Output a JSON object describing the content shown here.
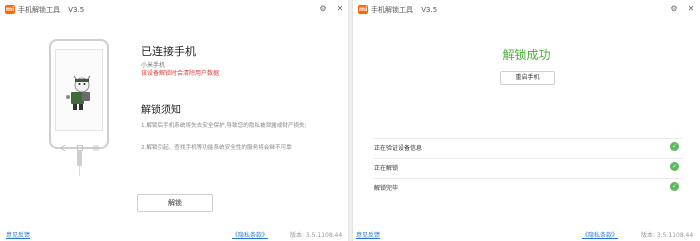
{
  "left": {
    "title_bar": {
      "logo": "mi",
      "app_name": "手机解锁工具",
      "version": "V3.5",
      "settings_icon": "gear-icon",
      "close_icon": "close-icon"
    },
    "status_title": "已连接手机",
    "device_name": "小米手机",
    "warning": "该设备解锁时会清除用户数据",
    "notice_title": "解锁须知",
    "notice_1": "1.解锁后手机系统将失去安全保护,导致您的隐私被泄露或财产损失;",
    "notice_2": "2.解锁引起、查找手机等功能系统安全性的服务将会继不可靠",
    "unlock_button": "解锁",
    "footer_feedback": "意见反馈",
    "footer_privacy": "《隐私条款》",
    "footer_version": "版本: 3.5.1108.44"
  },
  "right": {
    "title_bar": {
      "logo": "mi",
      "app_name": "手机解锁工具",
      "version": "V3.5",
      "settings_icon": "gear-icon",
      "close_icon": "close-icon"
    },
    "success_title": "解锁成功",
    "reboot_button": "重启手机",
    "steps": [
      {
        "label": "正在验证设备信息",
        "status": "done"
      },
      {
        "label": "正在解锁",
        "status": "done"
      },
      {
        "label": "解锁完毕",
        "status": "done"
      }
    ],
    "footer_feedback": "意见反馈",
    "footer_privacy": "《隐私条款》",
    "footer_version": "版本: 3.5.1108.44"
  },
  "colors": {
    "accent_orange": "#ff6700",
    "success_green": "#4caf3a",
    "warning_red": "#e03c3c",
    "link_blue": "#2a7ad5"
  }
}
